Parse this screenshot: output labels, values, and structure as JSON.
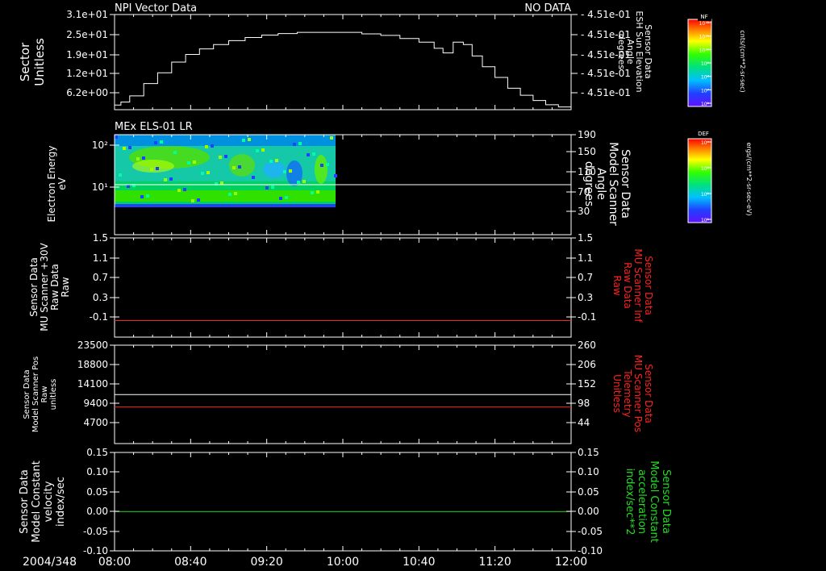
{
  "colors": {
    "white": "#ffffff",
    "red": "#ff2020",
    "green": "#22dd22",
    "bg": "#000000"
  },
  "time_axis": {
    "date_label": "2004/348",
    "tick_labels": [
      "08:00",
      "08:40",
      "09:20",
      "10:00",
      "10:40",
      "11:20",
      "12:00"
    ]
  },
  "chart_data": [
    {
      "type": "line",
      "title": "NPI Vector Data",
      "status": "NO DATA",
      "ylabel": [
        "Sector",
        "Unitless"
      ],
      "ylabel_right": [
        "Sensor Data",
        "ESH Sun Elevation",
        "Angle",
        "degrees"
      ],
      "ylim": [
        0,
        31
      ],
      "left_ticks": [
        "3.1e+01",
        "2.5e+01",
        "1.9e+01",
        "1.2e+01",
        "6.2e+00"
      ],
      "right_ticks": [
        "4.51e-01",
        "4.51e-01",
        "4.51e-01",
        "4.51e-01",
        "4.51e-01"
      ],
      "series": [
        {
          "x": [
            0,
            0.0139,
            0.0333,
            0.0639,
            0.0944,
            0.125,
            0.1556,
            0.1861,
            0.2167,
            0.25,
            0.2861,
            0.3222,
            0.3583,
            0.4,
            0.45,
            0.5,
            0.5417,
            0.5833,
            0.625,
            0.6667,
            0.7,
            0.7194,
            0.7417,
            0.7639,
            0.7833,
            0.8056,
            0.8333,
            0.8611,
            0.8889,
            0.9167,
            0.9444,
            0.9722,
            1
          ],
          "y": [
            1.5,
            2.5,
            4.5,
            8.5,
            12,
            15.5,
            18,
            19.8,
            21.2,
            22.5,
            23.5,
            24.3,
            24.8,
            25.2,
            25.2,
            25.2,
            24.7,
            24.2,
            23.2,
            22,
            20,
            18.5,
            22,
            21.2,
            17.5,
            14,
            10.5,
            7,
            4.7,
            3,
            1.6,
            0.9,
            0.7
          ]
        }
      ]
    },
    {
      "type": "heatmap",
      "title": "MEx ELS-01 LR",
      "ylabel": [
        "Electron Energy",
        "eV"
      ],
      "ylabel_right": [
        "Sensor Data",
        "Model Scanner",
        "Angle",
        "degrees"
      ],
      "yscale": "log",
      "left_ticks": [
        "10²",
        "10¹"
      ],
      "right_ticks": [
        "190",
        "150",
        "110",
        "70",
        "30"
      ],
      "data_extent_x": [
        0,
        1.833
      ],
      "scanner_angle_line": 100
    },
    {
      "type": "line",
      "ylabel": [
        "Sensor Data",
        "MU Scanner +30V",
        "Raw Data",
        "Raw"
      ],
      "ylabel_right": [
        "Sensor Data",
        "MU Scanner Inf",
        "Raw Data",
        "Raw"
      ],
      "ylim": [
        -0.3,
        1.5
      ],
      "left_ticks": [
        "1.5",
        "1.1",
        "0.7",
        "0.3",
        "-0.1"
      ],
      "right_ticks": [
        "1.5",
        "1.1",
        "0.7",
        "0.3",
        "-0.1"
      ],
      "line_value": 0
    },
    {
      "type": "line",
      "ylabel": [
        "Sensor Data",
        "Model Scanner Pos",
        "Raw",
        "unitless"
      ],
      "ylabel_right": [
        "Sensor Data",
        "MU Scanner Pos",
        "Telemetry",
        "Unitless"
      ],
      "left_ticks": [
        "23500",
        "18800",
        "14100",
        "9400",
        "4700"
      ],
      "right_ticks": [
        "260",
        "206",
        "152",
        "98",
        "44"
      ],
      "white_line_value": 11500,
      "red_line_value": 8500
    },
    {
      "type": "line",
      "ylabel": [
        "Sensor Data",
        "Model Constant",
        "velocity",
        "index/sec"
      ],
      "ylabel_right": [
        "Sensor Data",
        "Model Constant",
        "acceleration",
        "index/sec**2"
      ],
      "ylim": [
        -0.1,
        0.15
      ],
      "left_ticks": [
        "0.15",
        "0.10",
        "0.05",
        "0.00",
        "-0.05",
        "-0.10"
      ],
      "right_ticks": [
        "0.15",
        "0.10",
        "0.05",
        "0.00",
        "-0.05",
        "-0.10"
      ],
      "line_value": 0
    }
  ],
  "colorbars": [
    {
      "title": "NF",
      "unit": "cnts/(cm**2-sr-sec)",
      "tick_labels": [
        "10¹²",
        "10¹¹",
        "10¹⁰",
        "10⁹",
        "10⁸",
        "10⁷",
        "10⁶"
      ]
    },
    {
      "title": "DEF",
      "unit": "ergs/(cm**2-sr-sec-eV)",
      "tick_labels": [
        "10⁴",
        "10³",
        "10²",
        "10¹"
      ]
    }
  ]
}
